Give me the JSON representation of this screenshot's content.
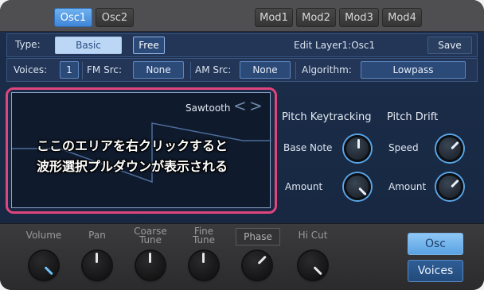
{
  "tabs": {
    "left": [
      "Osc1",
      "Osc2"
    ],
    "right": [
      "Mod1",
      "Mod2",
      "Mod3",
      "Mod4"
    ]
  },
  "row1": {
    "type_label": "Type:",
    "type_value": "Basic",
    "free_label": "Free",
    "edit_label": "Edit Layer1:Osc1",
    "save_label": "Save"
  },
  "row2": {
    "voices_label": "Voices:",
    "voices_value": "1",
    "fm_label": "FM Src:",
    "fm_value": "None",
    "am_label": "AM Src:",
    "am_value": "None",
    "algo_label": "Algorithm:",
    "algo_value": "Lowpass"
  },
  "waveform": {
    "name": "Sawtooth",
    "prev": "<",
    "next": ">",
    "note_line1": "ここのエリアを右クリックすると",
    "note_line2": "波形選択プルダウンが表示される"
  },
  "pitch": {
    "keytracking_title": "Pitch Keytracking",
    "drift_title": "Pitch Drift",
    "base_note_label": "Base Note",
    "amount_label_left": "Amount",
    "speed_label": "Speed",
    "amount_label_right": "Amount"
  },
  "bottom": {
    "volume": "Volume",
    "pan": "Pan",
    "coarse_tune_1": "Coarse",
    "coarse_tune_2": "Tune",
    "fine_tune_1": "Fine",
    "fine_tune_2": "Tune",
    "phase": "Phase",
    "hi_cut": "Hi Cut",
    "osc_button": "Osc",
    "voices_button": "Voices"
  },
  "colors": {
    "accent": "#4a90e2",
    "callout": "#e0457e"
  }
}
